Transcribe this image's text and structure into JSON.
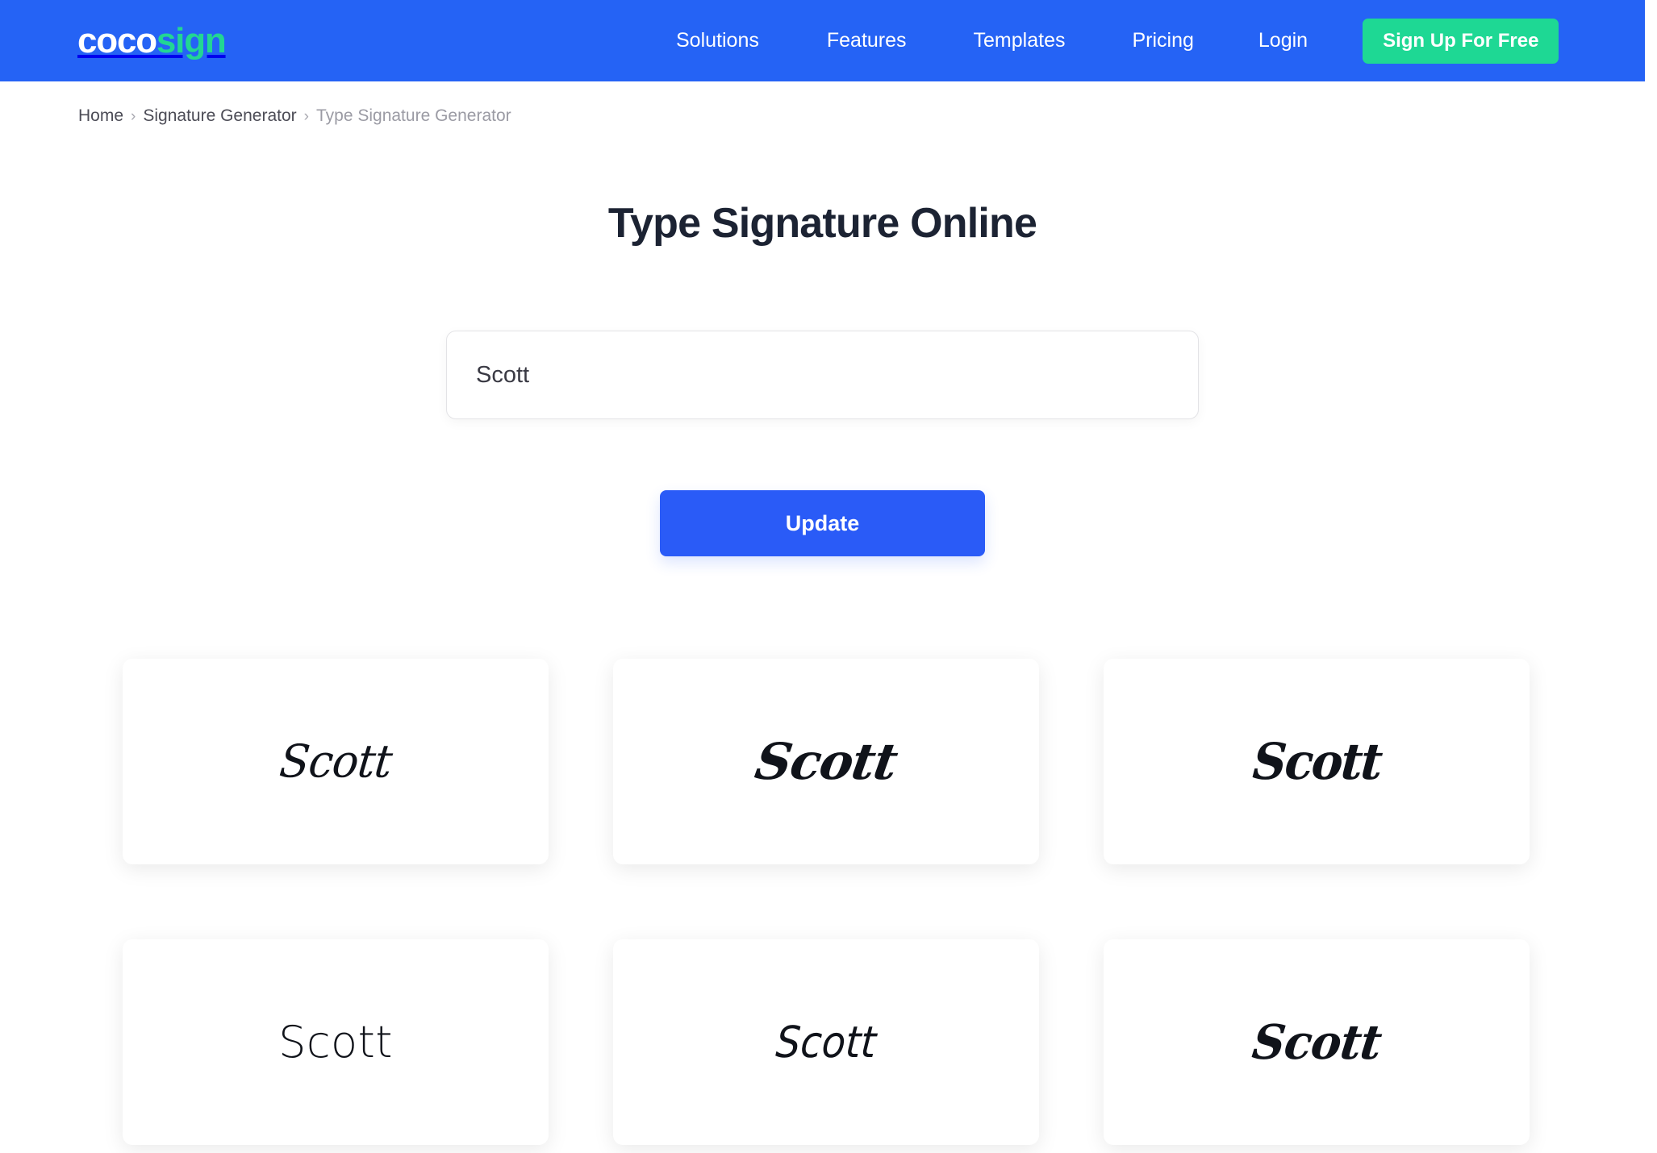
{
  "header": {
    "logo": {
      "part1": "coco",
      "part2": "sign"
    },
    "nav": [
      {
        "label": "Solutions",
        "key": "solutions"
      },
      {
        "label": "Features",
        "key": "features"
      },
      {
        "label": "Templates",
        "key": "templates"
      },
      {
        "label": "Pricing",
        "key": "pricing"
      },
      {
        "label": "Login",
        "key": "login"
      }
    ],
    "signup_label": "Sign Up For Free",
    "colors": {
      "bar": "#2563f5",
      "logo_accent": "#22d693",
      "signup_bg": "#1ed894"
    }
  },
  "breadcrumb": {
    "items": [
      {
        "label": "Home",
        "current": false
      },
      {
        "label": "Signature Generator",
        "current": false
      },
      {
        "label": "Type Signature Generator",
        "current": true
      }
    ],
    "separator": "›"
  },
  "main": {
    "title": "Type Signature Online",
    "name_input": {
      "value": "Scott",
      "placeholder": "Type your name here"
    },
    "update_button": {
      "label": "Update",
      "color": "#2a5bf7"
    },
    "signatures": [
      {
        "text": "Scott",
        "style": "style-1",
        "font_label": "elegant-script"
      },
      {
        "text": "Scott",
        "style": "style-2",
        "font_label": "bold-italic-script"
      },
      {
        "text": "Scott",
        "style": "style-3",
        "font_label": "heavy-brush-script"
      },
      {
        "text": "Scott",
        "style": "style-4",
        "font_label": "thin-print-hand"
      },
      {
        "text": "Scott",
        "style": "style-5",
        "font_label": "casual-marker-hand"
      },
      {
        "text": "Scott",
        "style": "style-6",
        "font_label": "looping-script"
      }
    ]
  }
}
